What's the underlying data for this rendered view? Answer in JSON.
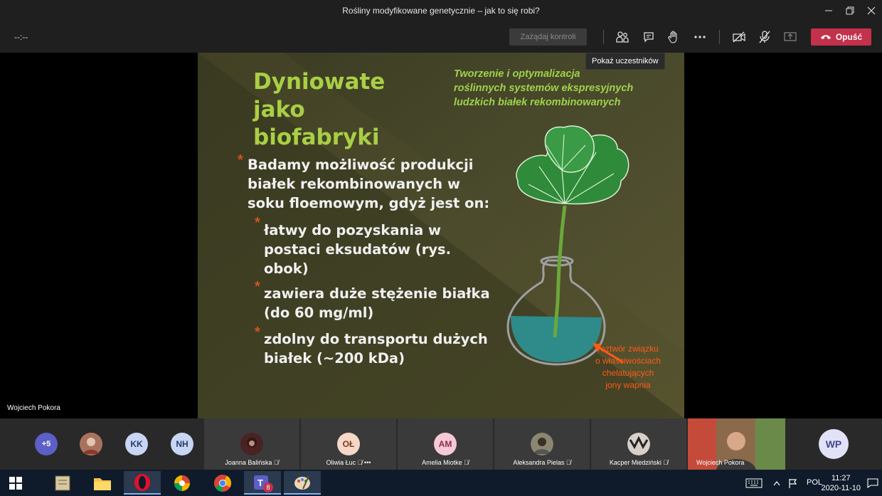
{
  "window": {
    "title": "Rośliny modyfikowane genetycznie – jak to się robi?"
  },
  "controls": {
    "timer": "--:--",
    "request_control": "Zażądaj kontroli",
    "leave": "Opuść",
    "tooltip": "Pokaż uczestników"
  },
  "slide": {
    "title_lines": [
      "Dyniowate",
      "jako",
      "biofabryki"
    ],
    "subtitle_lines": [
      "Tworzenie i optymalizacja",
      "roślinnych systemów ekspresyjnych",
      "ludzkich białek rekombinowanych"
    ],
    "main_bullet": [
      "Badamy możliwość produkcji",
      "białek rekombinowanych w",
      "soku floemowym, gdyż jest on:"
    ],
    "sub_bullets": [
      [
        "łatwy do pozyskania w",
        "postaci eksudatów (rys.",
        "obok)"
      ],
      [
        "zawiera duże stężenie białka",
        "(do 60 mg/ml)"
      ],
      [
        "zdolny do transportu dużych",
        "białek (~200 kDa)"
      ]
    ],
    "annotation": [
      "roztwór związku",
      "o właściwościach",
      "chelatujących",
      "jony wapnia"
    ]
  },
  "presenter_label": "Wojciech Pokora",
  "participants": {
    "overflow": "+5",
    "small_avatars": [
      {
        "initials": "",
        "color": "#b5432f"
      },
      {
        "initials": "KK",
        "color": "#c6d6f3"
      },
      {
        "initials": "NH",
        "color": "#c6d6f3"
      }
    ],
    "tiles": [
      {
        "name": "Joanna Balińska",
        "initials": "",
        "color": "#6a2a2a"
      },
      {
        "name": "Oliwia Łuc",
        "initials": "OŁ",
        "color": "#f6d7c8"
      },
      {
        "name": "Amelia Miotke",
        "initials": "AM",
        "color": "#f6c9d6"
      },
      {
        "name": "Aleksandra Pielas",
        "initials": "",
        "color": "#7a7a6a"
      },
      {
        "name": "Kacper Miedziński",
        "initials": "",
        "color": "#555"
      },
      {
        "name": "Wojciech Pokora",
        "initials": "",
        "color": "#6a4a3a"
      }
    ],
    "self": {
      "initials": "WP"
    }
  },
  "taskbar": {
    "language": "POL",
    "time": "11:27",
    "date": "2020-11-10",
    "teams_badge": "8"
  }
}
